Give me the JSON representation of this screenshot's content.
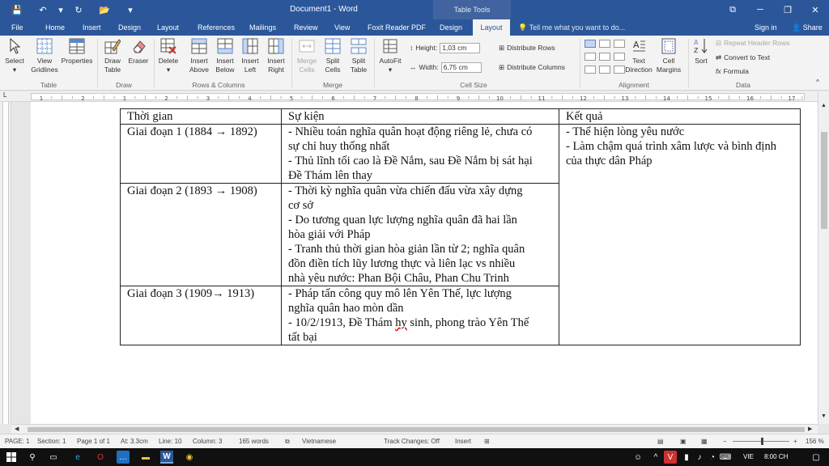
{
  "window": {
    "title": "Document1 - Word",
    "context_tab_group": "Table Tools",
    "controls": {
      "restore_ribbon": "⧉",
      "minimize": "─",
      "maximize": "❐",
      "close": "✕"
    }
  },
  "quick_access": {
    "save": "💾",
    "undo": "↶",
    "undo_arrow": "▾",
    "redo": "↻",
    "open": "📂",
    "customize": "▾"
  },
  "tabs": [
    "File",
    "Home",
    "Insert",
    "Design",
    "Layout",
    "References",
    "Mailings",
    "Review",
    "View",
    "Foxit Reader PDF",
    "Design",
    "Layout"
  ],
  "tell_me": "Tell me what you want to do...",
  "account": {
    "sign_in": "Sign in",
    "share": "Share"
  },
  "ribbon": {
    "table_group": {
      "select": "Select",
      "view_gridlines": "View Gridlines",
      "properties": "Properties",
      "label": "Table"
    },
    "draw_group": {
      "draw_table": "Draw Table",
      "eraser": "Eraser",
      "label": "Draw"
    },
    "rows_cols_group": {
      "delete": "Delete",
      "insert_above": "Insert Above",
      "insert_below": "Insert Below",
      "insert_left": "Insert Left",
      "insert_right": "Insert Right",
      "label": "Rows & Columns"
    },
    "merge_group": {
      "merge_cells": "Merge Cells",
      "split_cells": "Split Cells",
      "split_table": "Split Table",
      "label": "Merge"
    },
    "cell_size_group": {
      "autofit": "AutoFit",
      "height_label": "Height:",
      "height_value": "1,03 cm",
      "width_label": "Width:",
      "width_value": "6,75 cm",
      "distribute_rows": "Distribute Rows",
      "distribute_columns": "Distribute Columns",
      "label": "Cell Size"
    },
    "alignment_group": {
      "text_direction": "Text Direction",
      "cell_margins": "Cell Margins",
      "label": "Alignment"
    },
    "data_group": {
      "sort": "Sort",
      "repeat_header_rows": "Repeat Header Rows",
      "convert_to_text": "Convert to Text",
      "formula": "Formula",
      "label": "Data"
    }
  },
  "ruler_numbers": [
    "1",
    "2",
    "1",
    "2",
    "3",
    "4",
    "5",
    "6",
    "7",
    "8",
    "9",
    "10",
    "11",
    "12",
    "13",
    "14",
    "15",
    "16",
    "17",
    "18"
  ],
  "document": {
    "table": {
      "headers": [
        "Thời gian",
        "Sự kiện",
        "Kết quả"
      ],
      "rows": [
        {
          "period": "Giai đoạn 1 (1884 → 1892)",
          "events": [
            "- Nhiều toán nghĩa quân hoạt động riêng lẻ, chưa có",
            "sự chỉ huy thống nhất",
            "- Thủ lĩnh tối cao là Đề Nắm, sau Đề Nắm bị sát hại",
            "Đề Thám lên thay"
          ],
          "results": [
            "- Thể hiện lòng yêu nước",
            "- Làm chậm quá trình xâm lược và bình định",
            "của thực dân Pháp"
          ]
        },
        {
          "period": "Giai đoạn 2 (1893 → 1908)",
          "events": [
            "- Thời kỳ nghĩa quân vừa chiến đấu vừa xây dựng",
            "cơ sở",
            "- Do tương quan lực lượng nghĩa quân đã hai lần",
            "hòa giải với Pháp",
            "- Tranh thủ thời gian hòa giản lần từ 2; nghĩa quân",
            "đồn điền tích lũy lương thực và liên lạc vs nhiều",
            "nhà yêu nước: Phan Bội Châu, Phan Chu Trinh"
          ]
        },
        {
          "period": "Giai đoạn 3 (1909→ 1913)",
          "events": [
            "- Pháp tấn công quy mô lên Yên Thế, lực lượng",
            "nghĩa quân hao mòn dần"
          ],
          "events_last_pre": "- 10/2/1913, Đề Thám ",
          "events_last_err": "hy",
          "events_last_post": " sinh, phong trào Yên Thế",
          "events_end": "tất bại"
        }
      ]
    }
  },
  "status_bar": {
    "page": "PAGE: 1",
    "section": "Section: 1",
    "page_of": "Page 1 of 1",
    "at": "At: 3.3cm",
    "line": "Line: 10",
    "column": "Column: 3",
    "words": "165 words",
    "language": "Vietnamese",
    "track_changes": "Track Changes: Off",
    "mode": "Insert",
    "zoom": "156 %"
  },
  "taskbar": {
    "lang": "VIE",
    "time": "8:00 CH"
  },
  "colors": {
    "word_blue": "#2b579a",
    "ribbon_bg": "#f3f3f3",
    "taskbar": "#101010"
  }
}
